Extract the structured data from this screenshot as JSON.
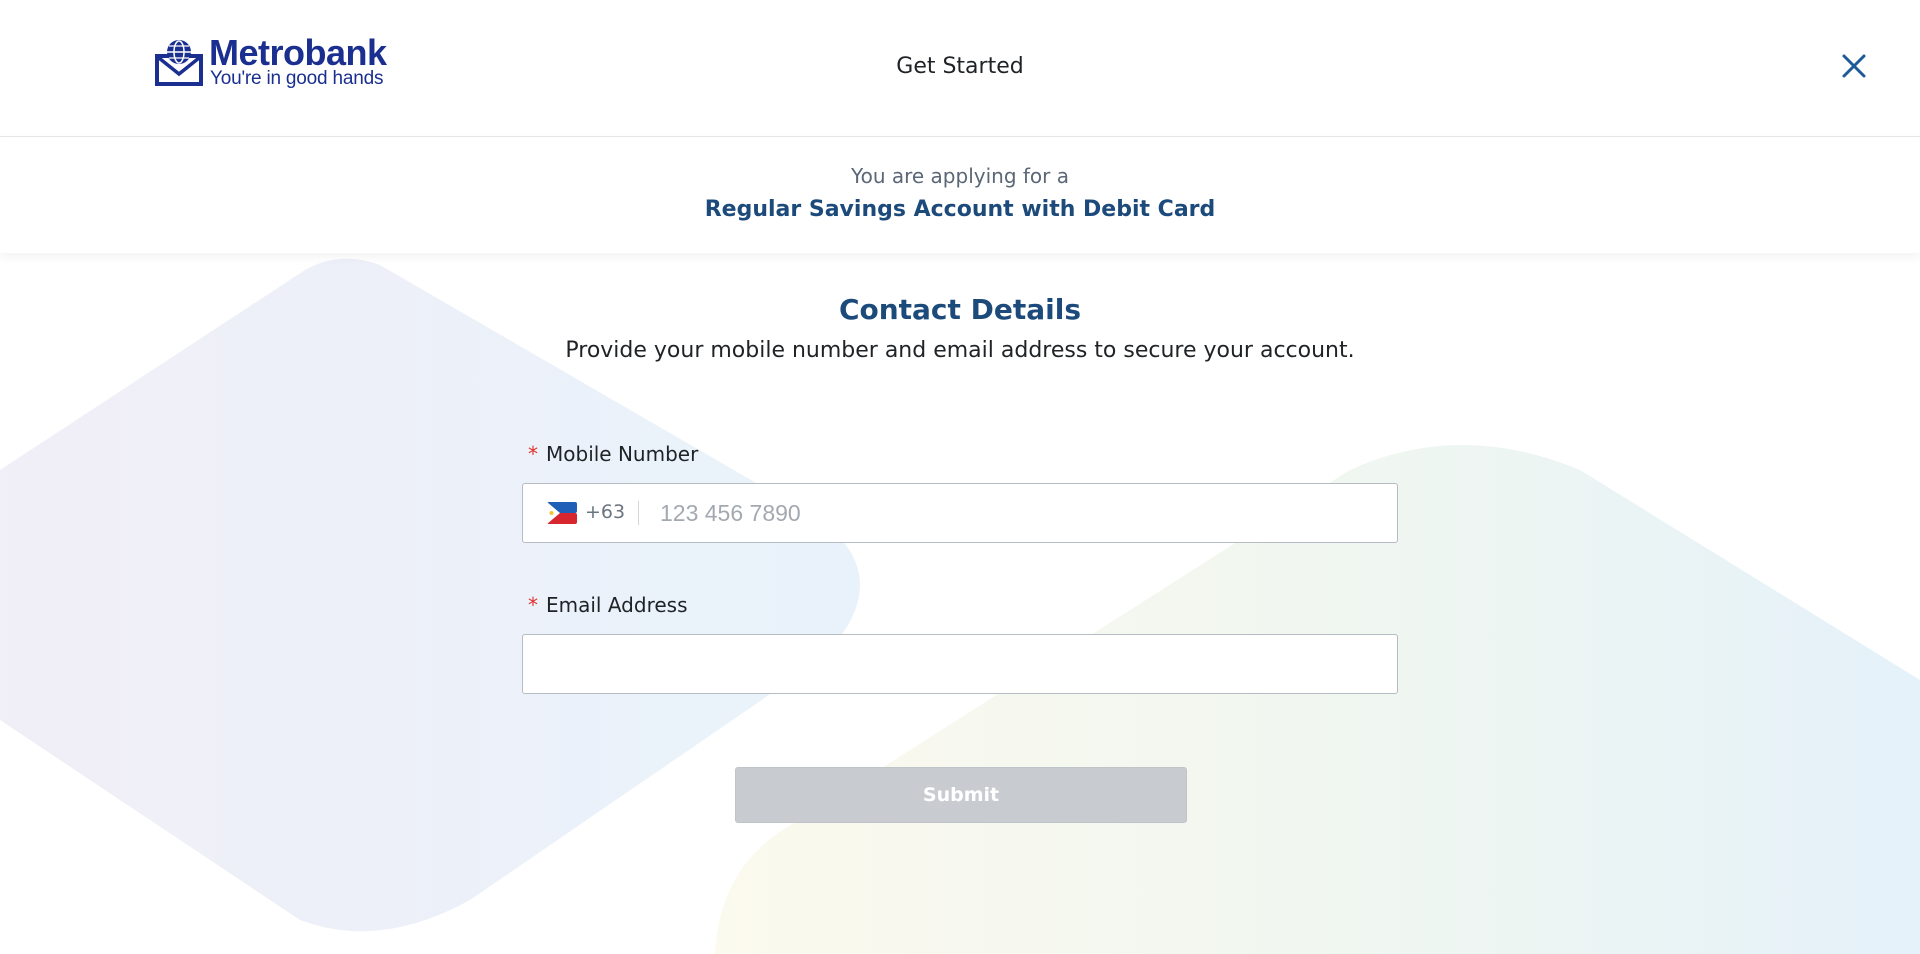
{
  "header": {
    "logo": {
      "name": "Metrobank",
      "tagline": "You're in good hands"
    },
    "title": "Get Started",
    "close_icon": "close-icon"
  },
  "banner": {
    "intro": "You are applying for a",
    "product": "Regular Savings Account with Debit Card"
  },
  "section": {
    "title": "Contact Details",
    "subtitle": "Provide your mobile number and email address to secure your account."
  },
  "form": {
    "required_mark": "*",
    "mobile": {
      "label": "Mobile Number",
      "country_flag": "philippines-flag-icon",
      "country_code": "+63",
      "placeholder": "123 456 7890",
      "value": ""
    },
    "email": {
      "label": "Email Address",
      "placeholder": "",
      "value": ""
    },
    "submit_label": "Submit",
    "submit_state": "disabled"
  },
  "colors": {
    "brand_blue": "#1a2f8f",
    "heading_blue": "#1c4a7a",
    "required_red": "#e0312b",
    "disabled_button": "#c8ccd1"
  }
}
